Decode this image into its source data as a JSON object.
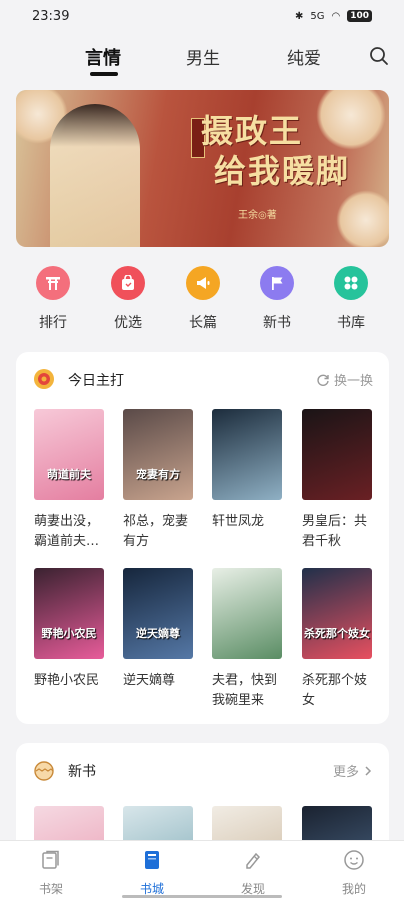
{
  "status": {
    "time": "23:39",
    "signal": "5G",
    "battery": "100"
  },
  "tabs": [
    {
      "label": "言情",
      "active": true
    },
    {
      "label": "男生",
      "active": false
    },
    {
      "label": "纯爱",
      "active": false
    }
  ],
  "banner": {
    "title_line1": "摄政王",
    "title_line2": "给我暖脚",
    "author": "王余◎著",
    "seal": "嫡女·甜宠"
  },
  "quick_links": [
    {
      "label": "排行",
      "color": "#f46f7c",
      "icon": "gate-icon"
    },
    {
      "label": "优选",
      "color": "#f0505a",
      "icon": "bag-icon"
    },
    {
      "label": "长篇",
      "color": "#f5a623",
      "icon": "megaphone-icon"
    },
    {
      "label": "新书",
      "color": "#8c7bf0",
      "icon": "flag-icon"
    },
    {
      "label": "书库",
      "color": "#26c39b",
      "icon": "grid-icon"
    }
  ],
  "today_section": {
    "title": "今日主打",
    "action": "换一换",
    "books": [
      {
        "title": "萌妻出没，霸道前夫…",
        "cover_text": "萌道前夫",
        "color1": "#f7c9d8",
        "color2": "#e47ea0"
      },
      {
        "title": "祁总，宠妻有方",
        "cover_text": "宠妻有方",
        "color1": "#5a4a48",
        "color2": "#c9a48e"
      },
      {
        "title": "轩世凤龙",
        "cover_text": "",
        "color1": "#1c2c3c",
        "color2": "#8fb0c4"
      },
      {
        "title": "男皇后：共君千秋",
        "cover_text": "",
        "color1": "#1a1416",
        "color2": "#6a2024"
      },
      {
        "title": "野艳小农民",
        "cover_text": "野艳小农民",
        "color1": "#3a2230",
        "color2": "#e85c9a"
      },
      {
        "title": "逆天嫡尊",
        "cover_text": "逆天嫡尊",
        "color1": "#16263c",
        "color2": "#5578a6"
      },
      {
        "title": "夫君，快到我碗里来",
        "cover_text": "",
        "color1": "#e8efe6",
        "color2": "#5a8d64"
      },
      {
        "title": "杀死那个妓女",
        "cover_text": "杀死那个妓女",
        "color1": "#20304a",
        "color2": "#e85060"
      }
    ]
  },
  "new_section": {
    "title": "新书",
    "action": "更多",
    "books": [
      {
        "color1": "#f5d9e2",
        "color2": "#e99ab0"
      },
      {
        "color1": "#d8e6ea",
        "color2": "#7aa8b4"
      },
      {
        "color1": "#f1ece4",
        "color2": "#c9b59a"
      },
      {
        "color1": "#1a2230",
        "color2": "#4e6a8a"
      }
    ]
  },
  "bottom_nav": [
    {
      "label": "书架",
      "active": false,
      "icon": "bookshelf-icon"
    },
    {
      "label": "书城",
      "active": true,
      "icon": "bookstore-icon"
    },
    {
      "label": "发现",
      "active": false,
      "icon": "discover-icon"
    },
    {
      "label": "我的",
      "active": false,
      "icon": "profile-icon"
    }
  ]
}
